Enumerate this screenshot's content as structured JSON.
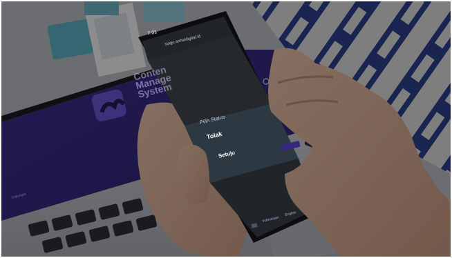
{
  "photo": {
    "description_colors": {
      "background_rug_blue": "#2b3f8a",
      "laptop_screen_purple": "#3e2f8a",
      "dim_overlay": "#000000"
    }
  },
  "laptop_screen": {
    "headline_lines": [
      "Conten",
      "Manage",
      "System"
    ],
    "footer_text": "Copyright"
  },
  "phone_screen": {
    "status_time": "7:31",
    "url": "siago.sehatdigital.id",
    "dialog": {
      "title": "Pilih Status",
      "options": [
        "Tolak",
        "Setuju"
      ]
    },
    "bottom_bar": {
      "lang_active": "Indonesian",
      "lang_other": "English"
    },
    "colors": {
      "accent_purple": "#5a48d6",
      "dialog_bg": "#4d6273"
    }
  }
}
